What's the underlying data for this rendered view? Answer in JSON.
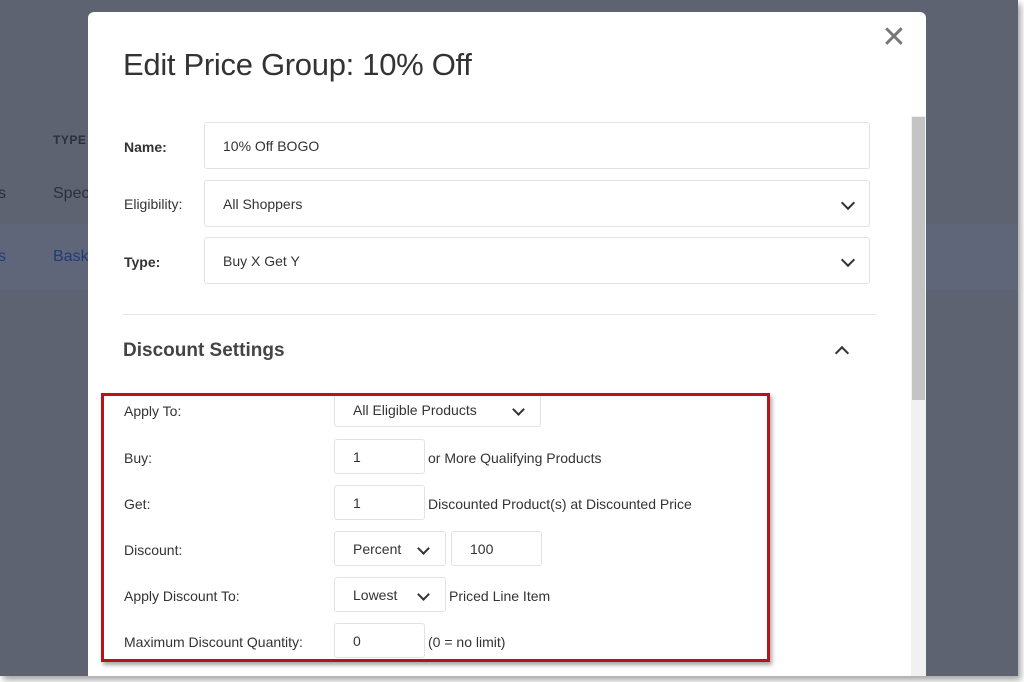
{
  "background": {
    "column_header": "TYPE",
    "rows": [
      {
        "left": "s",
        "type": "Spec"
      },
      {
        "left": "s",
        "type": "Bask"
      }
    ]
  },
  "modal": {
    "title": "Edit Price Group: 10% Off",
    "close_glyph": "✕",
    "name_label": "Name:",
    "name_value": "10% Off BOGO",
    "eligibility_label": "Eligibility:",
    "eligibility_value": "All Shoppers",
    "type_label": "Type:",
    "type_value": "Buy X Get Y",
    "section_title": "Discount Settings",
    "settings": {
      "apply_to_label": "Apply To:",
      "apply_to_value": "All Eligible Products",
      "buy_label": "Buy:",
      "buy_value": "1",
      "buy_suffix": "or More Qualifying Products",
      "get_label": "Get:",
      "get_value": "1",
      "get_suffix": "Discounted Product(s) at Discounted Price",
      "discount_label": "Discount:",
      "discount_type": "Percent",
      "discount_value": "100",
      "apply_discount_to_label": "Apply Discount To:",
      "apply_discount_to_value": "Lowest",
      "apply_discount_to_suffix": "Priced Line Item",
      "max_qty_label": "Maximum Discount Quantity:",
      "max_qty_value": "0",
      "max_qty_suffix": "(0 = no limit)"
    }
  },
  "colors": {
    "overlay": "#5e6372",
    "highlight_border": "#b5141c",
    "modal_bg": "#ffffff",
    "link": "#213b74"
  }
}
